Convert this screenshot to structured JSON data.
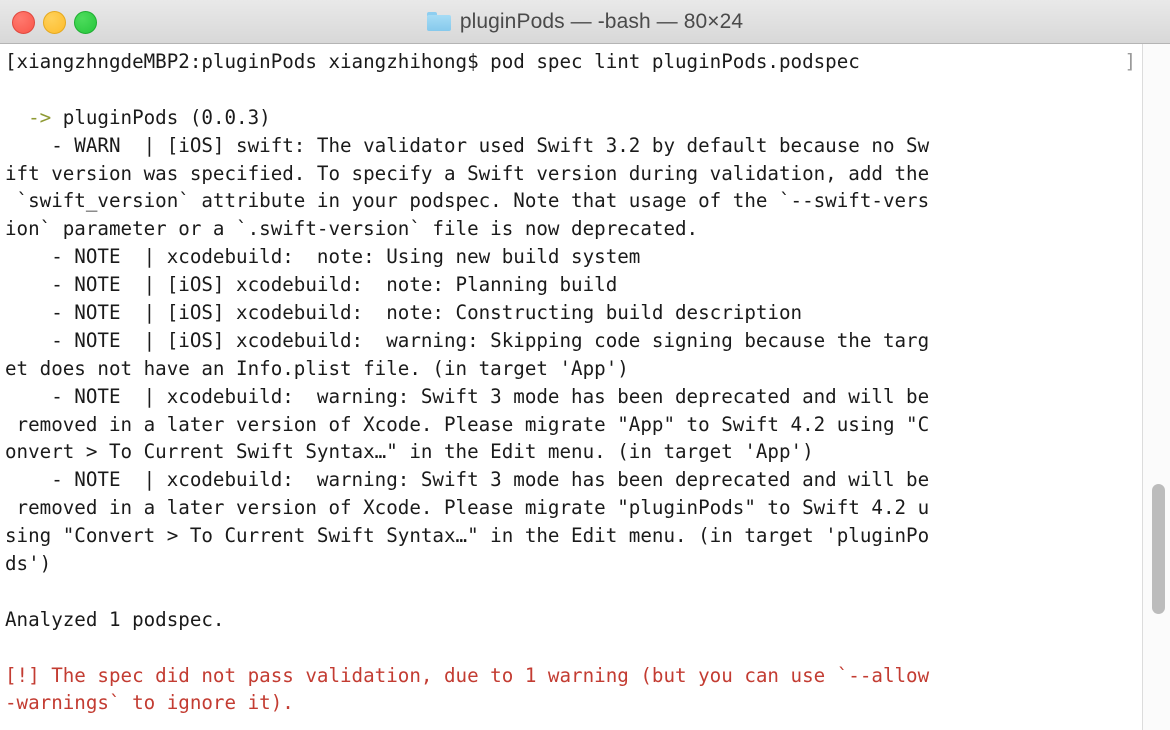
{
  "window": {
    "title": "pluginPods — -bash — 80×24",
    "folder_icon": "folder-icon",
    "traffic_lights": [
      {
        "name": "close",
        "color": "#f9564a"
      },
      {
        "name": "minimize",
        "color": "#fdbc2c"
      },
      {
        "name": "maximize",
        "color": "#27c63c"
      }
    ]
  },
  "colors": {
    "text": "#1a1a1a",
    "green": "#8f9a34",
    "red": "#c33c32",
    "background": "#ffffff",
    "titlebar": "#e0e0e0"
  },
  "gutter": {
    "pane_button": "split-pane-icon",
    "scrollbar": "vertical-scrollbar"
  },
  "terminal": {
    "prompt": "[xiangzhngdeMBP2:pluginPods xiangzhihong$ pod spec lint pluginPods.podspec",
    "lines": [
      {
        "id": "l00",
        "color": "default",
        "text": "[xiangzhngdeMBP2:pluginPods xiangzhihong$ pod spec lint pluginPods.podspec"
      },
      {
        "id": "l01",
        "color": "default",
        "text": ""
      },
      {
        "id": "l02",
        "color": "mixed",
        "green": "  -> ",
        "text": "pluginPods (0.0.3)"
      },
      {
        "id": "l03",
        "color": "default",
        "text": "    - WARN  | [iOS] swift: The validator used Swift 3.2 by default because no Sw"
      },
      {
        "id": "l04",
        "color": "default",
        "text": "ift version was specified. To specify a Swift version during validation, add the"
      },
      {
        "id": "l05",
        "color": "default",
        "text": " `swift_version` attribute in your podspec. Note that usage of the `--swift-vers"
      },
      {
        "id": "l06",
        "color": "default",
        "text": "ion` parameter or a `.swift-version` file is now deprecated."
      },
      {
        "id": "l07",
        "color": "default",
        "text": "    - NOTE  | xcodebuild:  note: Using new build system"
      },
      {
        "id": "l08",
        "color": "default",
        "text": "    - NOTE  | [iOS] xcodebuild:  note: Planning build"
      },
      {
        "id": "l09",
        "color": "default",
        "text": "    - NOTE  | [iOS] xcodebuild:  note: Constructing build description"
      },
      {
        "id": "l10",
        "color": "default",
        "text": "    - NOTE  | [iOS] xcodebuild:  warning: Skipping code signing because the targ"
      },
      {
        "id": "l11",
        "color": "default",
        "text": "et does not have an Info.plist file. (in target 'App')"
      },
      {
        "id": "l12",
        "color": "default",
        "text": "    - NOTE  | xcodebuild:  warning: Swift 3 mode has been deprecated and will be"
      },
      {
        "id": "l13",
        "color": "default",
        "text": " removed in a later version of Xcode. Please migrate \"App\" to Swift 4.2 using \"C"
      },
      {
        "id": "l14",
        "color": "default",
        "text": "onvert > To Current Swift Syntax…\" in the Edit menu. (in target 'App')"
      },
      {
        "id": "l15",
        "color": "default",
        "text": "    - NOTE  | xcodebuild:  warning: Swift 3 mode has been deprecated and will be"
      },
      {
        "id": "l16",
        "color": "default",
        "text": " removed in a later version of Xcode. Please migrate \"pluginPods\" to Swift 4.2 u"
      },
      {
        "id": "l17",
        "color": "default",
        "text": "sing \"Convert > To Current Swift Syntax…\" in the Edit menu. (in target 'pluginPo"
      },
      {
        "id": "l18",
        "color": "default",
        "text": "ds')"
      },
      {
        "id": "l19",
        "color": "default",
        "text": ""
      },
      {
        "id": "l20",
        "color": "default",
        "text": "Analyzed 1 podspec."
      },
      {
        "id": "l21",
        "color": "default",
        "text": ""
      },
      {
        "id": "l22",
        "color": "red",
        "text": "[!] The spec did not pass validation, due to 1 warning (but you can use `--allow"
      },
      {
        "id": "l23",
        "color": "red",
        "text": "-warnings` to ignore it)."
      }
    ],
    "trailing_bracket": "]"
  }
}
